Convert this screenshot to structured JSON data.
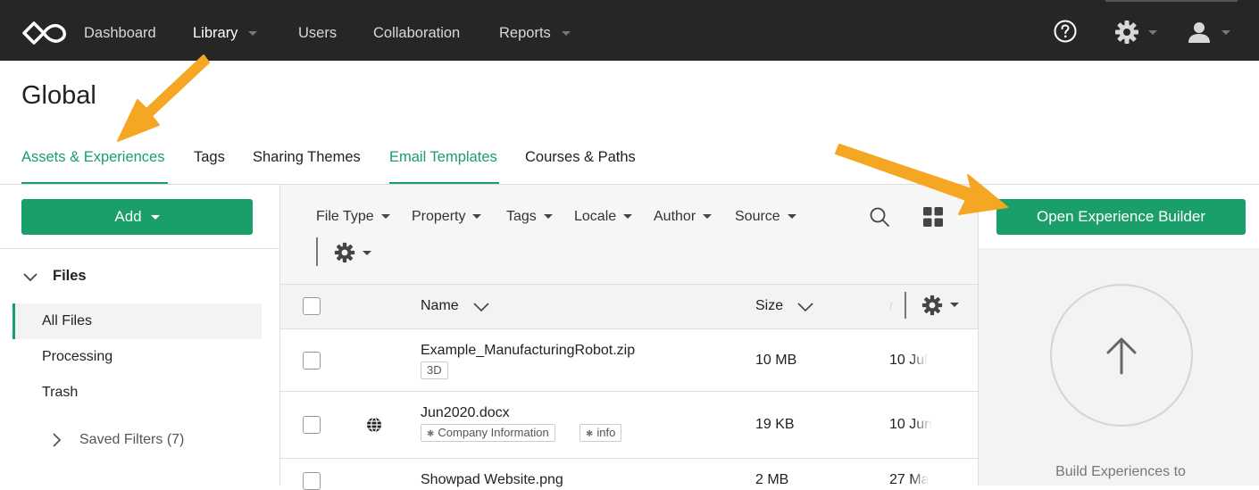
{
  "topnav": {
    "items": [
      {
        "label": "Dashboard",
        "active": false,
        "dropdown": false
      },
      {
        "label": "Library",
        "active": true,
        "dropdown": true
      },
      {
        "label": "Users",
        "active": false,
        "dropdown": false
      },
      {
        "label": "Collaboration",
        "active": false,
        "dropdown": false
      },
      {
        "label": "Reports",
        "active": false,
        "dropdown": true
      }
    ],
    "icons": [
      "help-icon",
      "gear-icon",
      "user-icon"
    ]
  },
  "page": {
    "title": "Global",
    "tabs": [
      {
        "label": "Assets & Experiences",
        "active": true
      },
      {
        "label": "Tags",
        "active": false
      },
      {
        "label": "Sharing Themes",
        "active": false
      },
      {
        "label": "Email Templates",
        "active": false,
        "highlight": true
      },
      {
        "label": "Courses & Paths",
        "active": false
      }
    ]
  },
  "sidebar": {
    "add_label": "Add",
    "files_label": "Files",
    "items": [
      {
        "label": "All Files",
        "active": true
      },
      {
        "label": "Processing",
        "active": false
      },
      {
        "label": "Trash",
        "active": false
      }
    ],
    "saved_filters": "Saved Filters (7)"
  },
  "filters": [
    "File Type",
    "Property",
    "Tags",
    "Locale",
    "Author",
    "Source"
  ],
  "table": {
    "columns": {
      "name": "Name",
      "size": "Size",
      "truncated": "/"
    },
    "rows": [
      {
        "name": "Example_ManufacturingRobot.zip",
        "size": "10 MB",
        "date": "10 Jul",
        "tags": [
          "3D"
        ],
        "tag_icons": false
      },
      {
        "name": "Jun2020.docx",
        "size": "19 KB",
        "date": "10 Jun",
        "tags": [
          "Company Information",
          "info"
        ],
        "tag_icons": true,
        "globe": true
      },
      {
        "name": "Showpad Website.png",
        "size": "2 MB",
        "date": "27 Ma",
        "tags": [],
        "tag_icons": false
      }
    ]
  },
  "right_panel": {
    "open_builder_label": "Open Experience Builder",
    "build_text": "Build Experiences to"
  },
  "colors": {
    "accent": "#1a9e6a",
    "topnav_bg": "#262626",
    "annotation_arrow": "#f5a623"
  }
}
